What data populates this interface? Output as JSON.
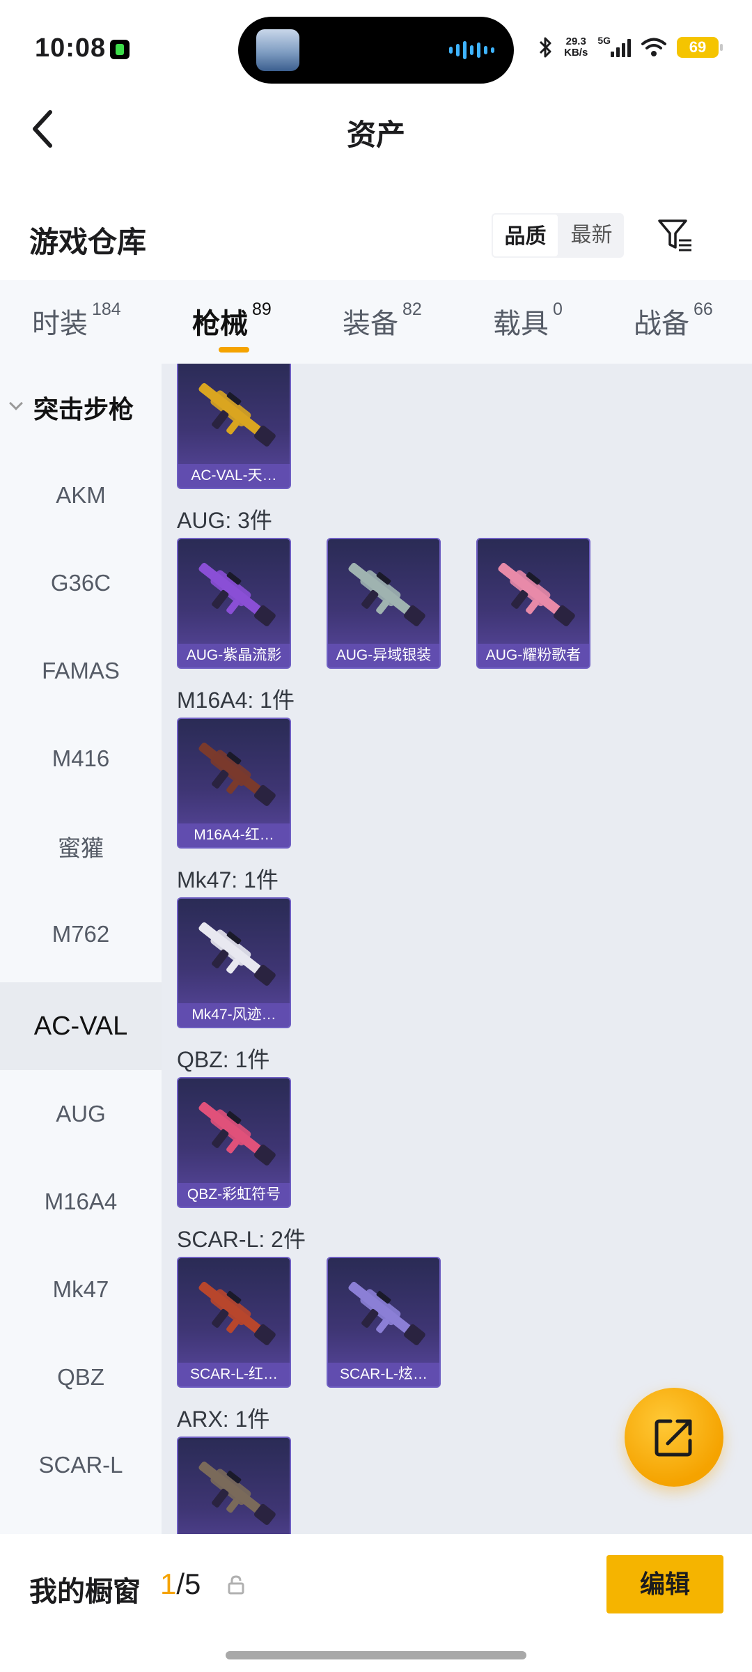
{
  "status_bar": {
    "time": "10:08",
    "net_speed_value": "29.3",
    "net_speed_unit": "KB/s",
    "network_type": "5G",
    "battery": "69",
    "accent_color": "#f5c400"
  },
  "header": {
    "title": "资产",
    "back_icon": "chevron-left-icon"
  },
  "warehouse": {
    "title": "游戏仓库",
    "sort_options": [
      "品质",
      "最新"
    ],
    "sort_selected": "品质",
    "filter_icon": "filter-icon"
  },
  "tabs": [
    {
      "label": "时装",
      "count": "184"
    },
    {
      "label": "枪械",
      "count": "89"
    },
    {
      "label": "装备",
      "count": "82"
    },
    {
      "label": "载具",
      "count": "0"
    },
    {
      "label": "战备",
      "count": "66"
    }
  ],
  "active_tab": "枪械",
  "sidebar": {
    "group": "突击步枪",
    "items": [
      "AKM",
      "G36C",
      "FAMAS",
      "M416",
      "蜜獾",
      "M762",
      "AC-VAL",
      "AUG",
      "M16A4",
      "Mk47",
      "QBZ",
      "SCAR-L"
    ],
    "selected": "AC-VAL"
  },
  "content": {
    "groups": [
      {
        "label": "",
        "items": [
          {
            "name": "AC-VAL-天…",
            "color": "#d9a520"
          }
        ]
      },
      {
        "label": "AUG: 3件",
        "items": [
          {
            "name": "AUG-紫晶流影",
            "color": "#8a4fd6"
          },
          {
            "name": "AUG-异域银装",
            "color": "#9fb3b0"
          },
          {
            "name": "AUG-耀粉歌者",
            "color": "#e88aa8"
          }
        ]
      },
      {
        "label": "M16A4: 1件",
        "items": [
          {
            "name": "M16A4-红…",
            "color": "#7a3a2c"
          }
        ]
      },
      {
        "label": "Mk47: 1件",
        "items": [
          {
            "name": "Mk47-风迹…",
            "color": "#e8e8f0"
          }
        ]
      },
      {
        "label": "QBZ: 1件",
        "items": [
          {
            "name": "QBZ-彩虹符号",
            "color": "#e0517a"
          }
        ]
      },
      {
        "label": "SCAR-L: 2件",
        "items": [
          {
            "name": "SCAR-L-红…",
            "color": "#b8462c"
          },
          {
            "name": "SCAR-L-炫…",
            "color": "#8b7fd6"
          }
        ]
      },
      {
        "label": "ARX: 1件",
        "items": [
          {
            "name": "",
            "color": "#7a6a5a"
          }
        ]
      }
    ]
  },
  "fab_icon": "share-external-icon",
  "bottom": {
    "showcase_label": "我的橱窗",
    "showcase_current": "1",
    "showcase_total": "/5",
    "lock_icon": "lock-icon",
    "edit_label": "编辑"
  }
}
